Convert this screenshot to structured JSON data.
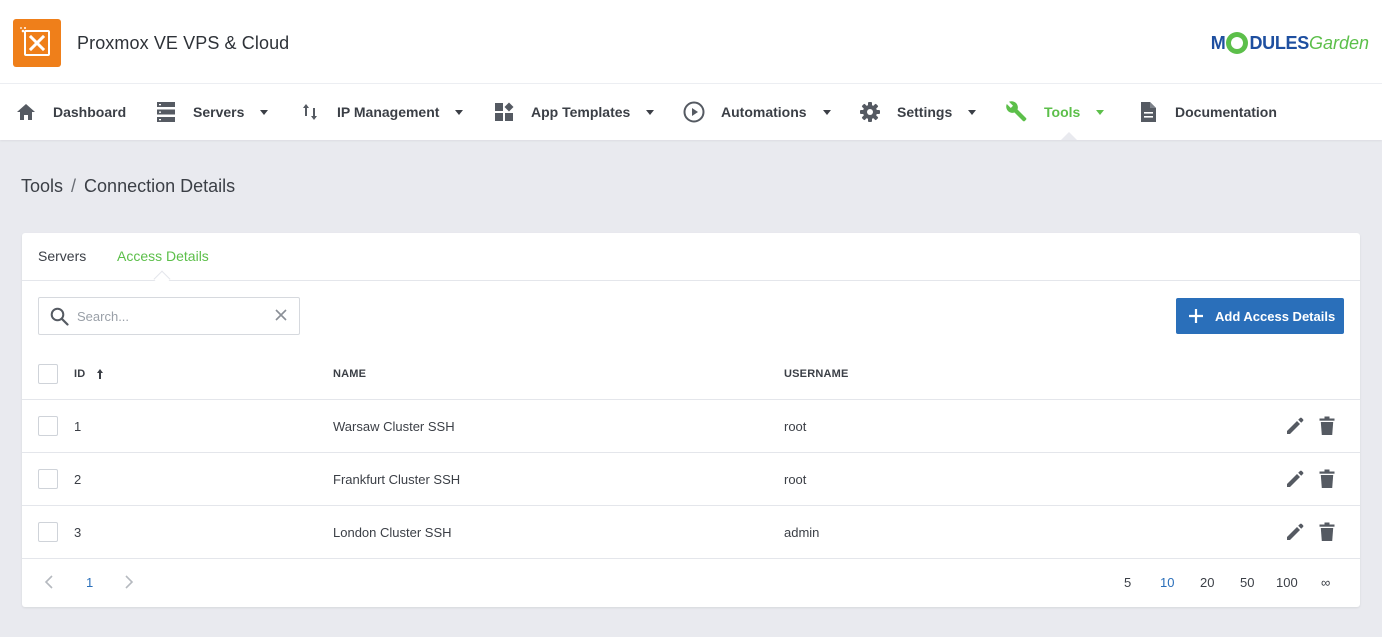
{
  "header": {
    "app_title": "Proxmox VE VPS & Cloud",
    "brand": {
      "part1": "M",
      "part2": "DULES",
      "part3": "Garden"
    },
    "accent_color": "#ef7f1a"
  },
  "nav": {
    "items": [
      {
        "label": "Dashboard",
        "icon": "home-icon"
      },
      {
        "label": "Servers",
        "icon": "servers-icon"
      },
      {
        "label": "IP Management",
        "icon": "arrows-up-down-icon"
      },
      {
        "label": "App Templates",
        "icon": "widgets-icon"
      },
      {
        "label": "Automations",
        "icon": "play-circle-icon"
      },
      {
        "label": "Settings",
        "icon": "gear-icon"
      },
      {
        "label": "Tools",
        "icon": "wrench-icon",
        "active": true
      },
      {
        "label": "Documentation",
        "icon": "document-icon"
      }
    ],
    "active_color": "#5cbf4a"
  },
  "breadcrumb": {
    "parent": "Tools",
    "separator": "/",
    "current": "Connection Details"
  },
  "tabs": [
    {
      "label": "Servers",
      "active": false
    },
    {
      "label": "Access Details",
      "active": true
    }
  ],
  "search": {
    "placeholder": "Search...",
    "value": ""
  },
  "toolbar": {
    "add_label": "Add Access Details",
    "button_color": "#2a6fba"
  },
  "table": {
    "columns": {
      "id": "ID",
      "name": "NAME",
      "username": "USERNAME"
    },
    "sort_column": "ID",
    "sort_direction": "ascending",
    "rows": [
      {
        "id": "1",
        "name": "Warsaw Cluster SSH",
        "username": "root"
      },
      {
        "id": "2",
        "name": "Frankfurt Cluster SSH",
        "username": "root"
      },
      {
        "id": "3",
        "name": "London Cluster SSH",
        "username": "admin"
      }
    ]
  },
  "pagination": {
    "current_page": "1",
    "page_sizes": [
      "5",
      "10",
      "20",
      "50",
      "100",
      "∞"
    ],
    "active_page_size": "10"
  }
}
